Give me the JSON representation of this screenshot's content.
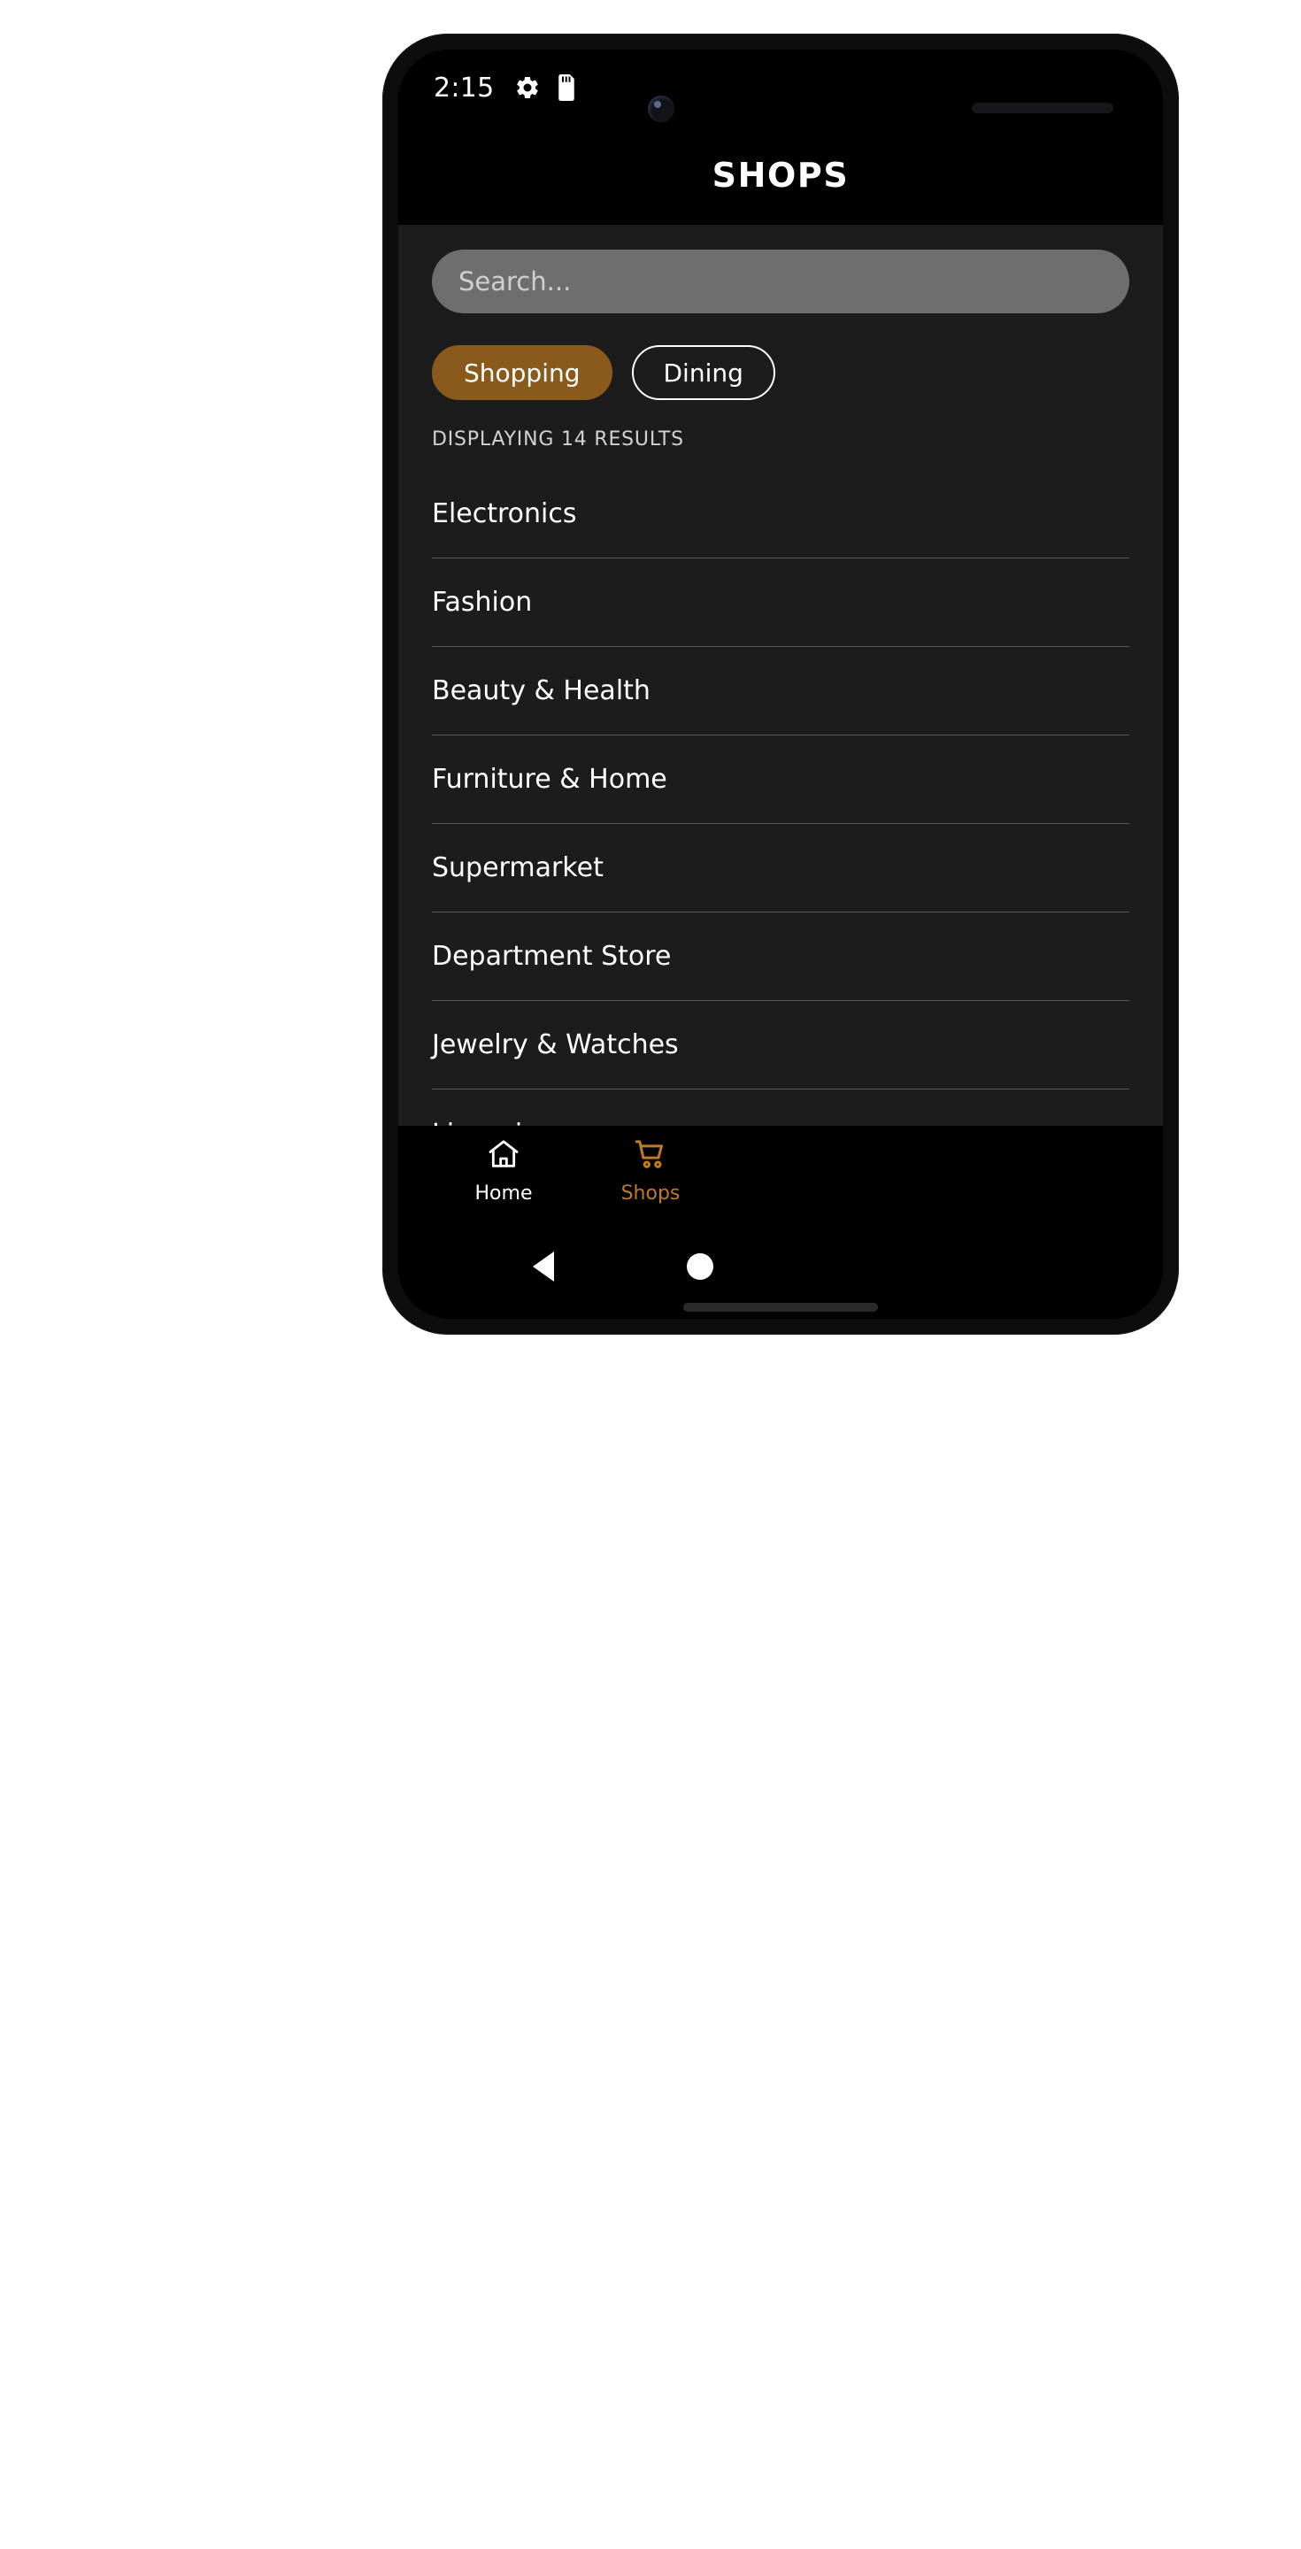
{
  "status_bar": {
    "time": "2:15",
    "icons": [
      "gear-icon",
      "sd-card-icon"
    ]
  },
  "app_bar": {
    "title": "SHOPS"
  },
  "search": {
    "placeholder": "Search...",
    "value": ""
  },
  "filters": {
    "chips": [
      {
        "label": "Shopping",
        "selected": true
      },
      {
        "label": "Dining",
        "selected": false
      }
    ]
  },
  "results": {
    "count_label": "DISPLAYING 14 RESULTS",
    "count": 14
  },
  "categories": [
    {
      "label": "Electronics"
    },
    {
      "label": "Fashion"
    },
    {
      "label": "Beauty & Health"
    },
    {
      "label": "Furniture & Home"
    },
    {
      "label": "Supermarket"
    },
    {
      "label": "Department Store"
    },
    {
      "label": "Jewelry & Watches"
    },
    {
      "label": "Lingerie"
    }
  ],
  "bottom_nav": [
    {
      "label": "Home",
      "icon": "home-icon",
      "active": false
    },
    {
      "label": "Shops",
      "icon": "shopping-cart-icon",
      "active": true
    }
  ],
  "system_nav": {
    "back": "back-triangle-icon",
    "home": "home-circle-icon"
  },
  "colors": {
    "accent": "#8a5a1c",
    "accent_text": "#c07a22",
    "screen_bg": "#1c1c1c",
    "bar_bg": "#000000",
    "search_bg": "#6e6e6e",
    "divider": "#5a5a5a",
    "text_primary": "#ffffff"
  }
}
